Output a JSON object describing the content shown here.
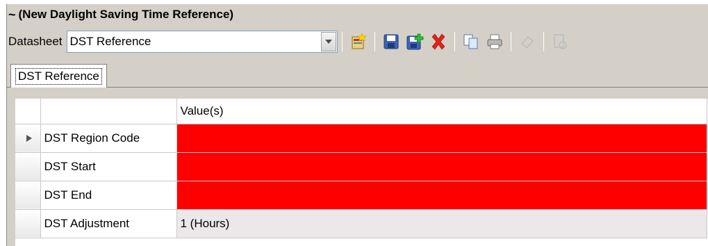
{
  "window": {
    "title": "(New Daylight Saving Time Reference)",
    "title_prefix": "~"
  },
  "toolbar": {
    "datasheet_label": "Datasheet",
    "datasheet_value": "DST Reference",
    "buttons": [
      {
        "icon": "new-record-icon",
        "enabled": true
      },
      {
        "icon": "save-icon",
        "enabled": true
      },
      {
        "icon": "save-and-new-icon",
        "enabled": true
      },
      {
        "icon": "delete-icon",
        "enabled": true
      },
      {
        "icon": "copy-icon",
        "enabled": true
      },
      {
        "icon": "print-icon",
        "enabled": true
      },
      {
        "icon": "eraser-icon",
        "enabled": false
      },
      {
        "icon": "report-icon",
        "enabled": false
      }
    ]
  },
  "tabs": [
    {
      "label": "DST Reference",
      "active": true
    }
  ],
  "grid": {
    "columns": [
      "",
      "Value(s)"
    ],
    "rows": [
      {
        "field": "DST Region Code",
        "value": "",
        "required_empty": true,
        "current": true
      },
      {
        "field": "DST Start",
        "value": "",
        "required_empty": true,
        "current": false
      },
      {
        "field": "DST End",
        "value": "",
        "required_empty": true,
        "current": false
      },
      {
        "field": "DST Adjustment",
        "value": "1 (Hours)",
        "required_empty": false,
        "current": false
      }
    ]
  },
  "colors": {
    "required_empty": "#ff0000",
    "panel_bg": "#d4d0c8",
    "value_bg": "#ece8ea"
  }
}
